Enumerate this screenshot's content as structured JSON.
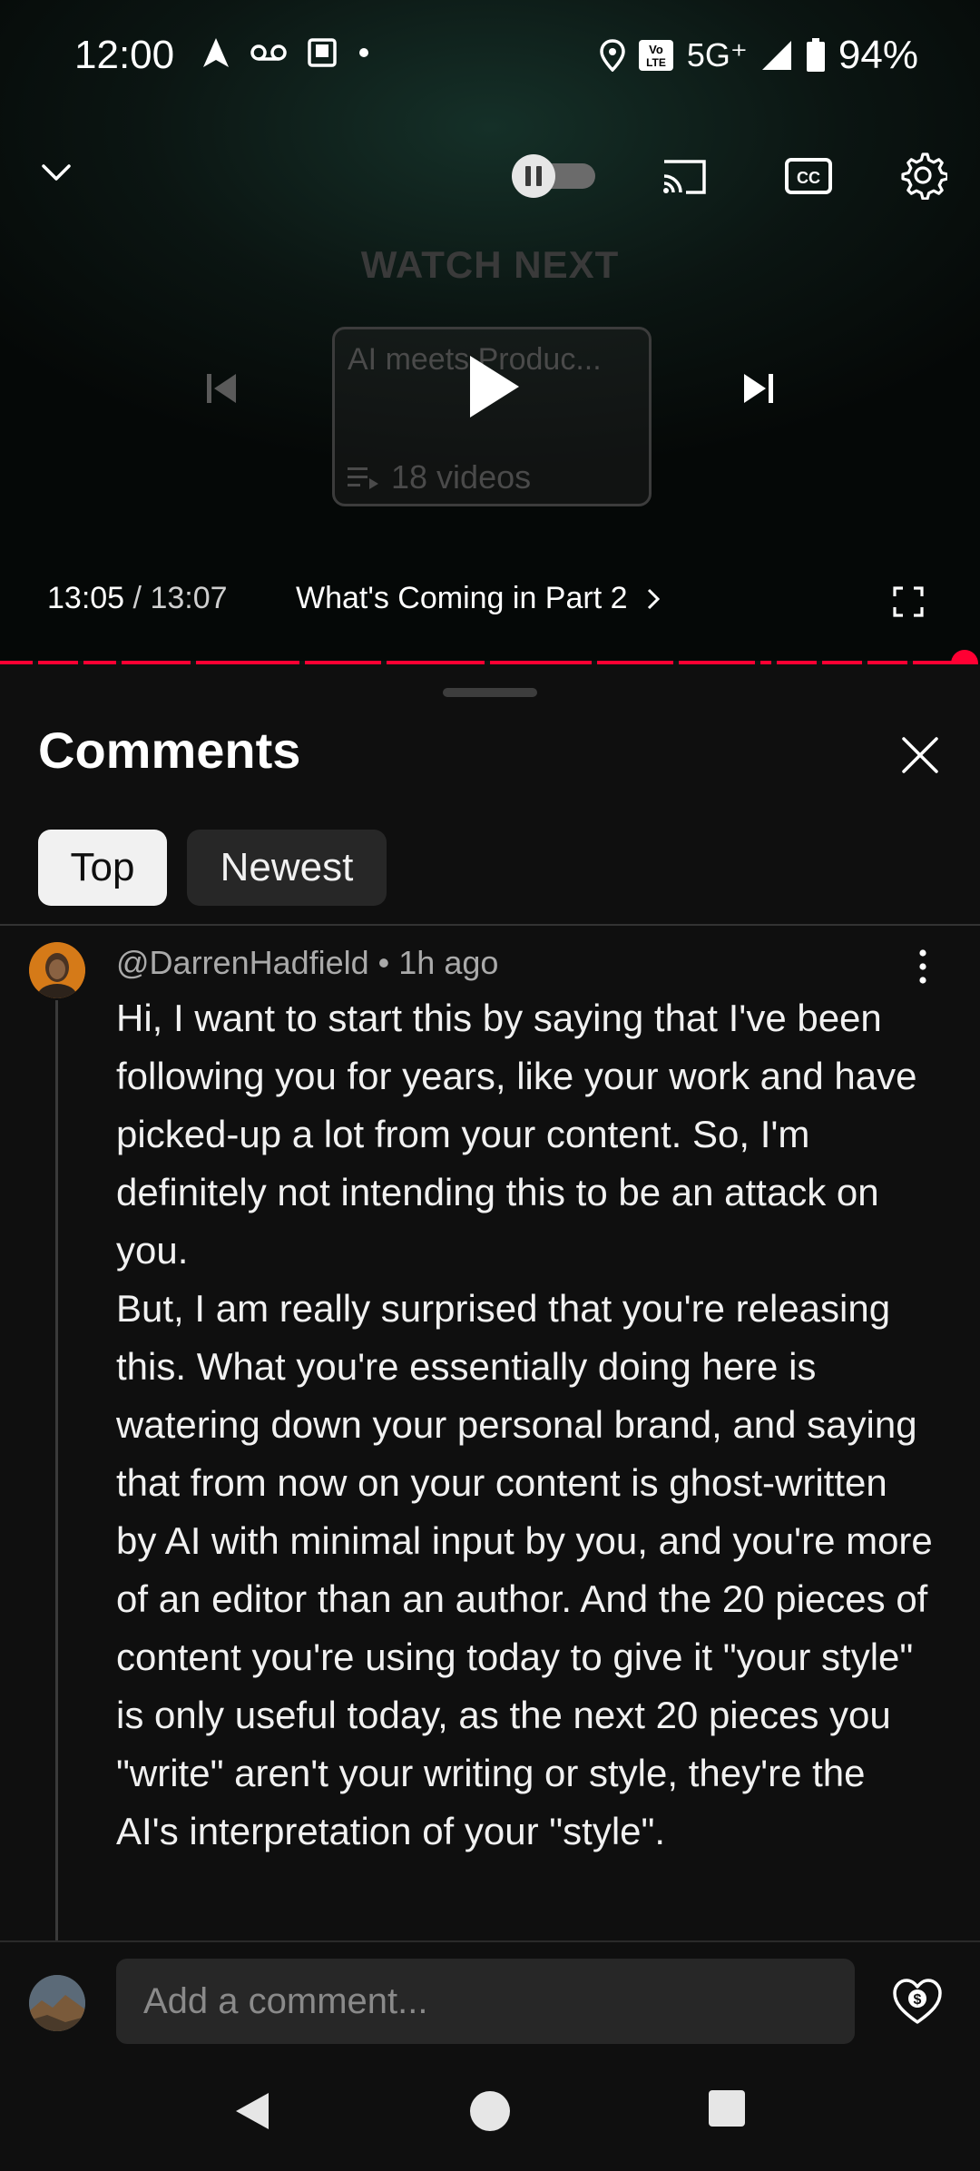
{
  "status_bar": {
    "time": "12:00",
    "network": "5G⁺",
    "battery": "94%",
    "volte": "Vo\nLTE"
  },
  "player": {
    "watch_next": "WATCH NEXT",
    "playlist_title": "AI meets Produc...",
    "playlist_count": "18 videos",
    "current_time": "13:05",
    "duration": "/ 13:07",
    "chapter": "What's Coming in Part 2",
    "progress_fraction": 0.998,
    "autoplay": "paused"
  },
  "comments": {
    "title": "Comments",
    "chips": [
      "Top",
      "Newest"
    ],
    "selected_chip": "Top",
    "items": [
      {
        "author": "@DarrenHadfield",
        "separator": " • ",
        "age": "1h ago",
        "text": "Hi, I want to start this by saying that I've been following you for years, like your work and have picked-up a lot from your content. So, I'm definitely not intending this to be an attack on you.\nBut, I am really surprised that you're releasing this. What you're essentially doing here is watering down your personal brand, and saying that from now on your content is ghost-written by AI with minimal input by you, and you're more of an editor than an author. And the 20 pieces of content you're using today to give it \"your style\" is only useful today, as the next 20 pieces you \"write\" aren't your writing or style, they're the AI's interpretation of your \"style\"."
      }
    ]
  },
  "composer": {
    "placeholder": "Add a comment..."
  },
  "colors": {
    "accent": "#ff0033",
    "background": "#0f0f0f",
    "chip_selected": "#f1f1f1",
    "chip_default": "#272727"
  }
}
